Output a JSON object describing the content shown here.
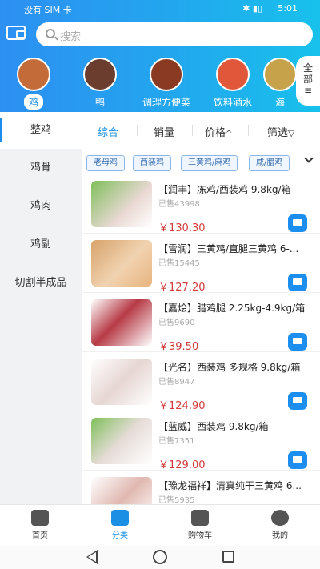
{
  "status": {
    "left": "没有 SIM 卡",
    "time": "5:01",
    "icons": "✱ ▮▯"
  },
  "search": {
    "placeholder": "搜索"
  },
  "categories": [
    {
      "label": "鸡",
      "active": true,
      "color": "#c46b3a"
    },
    {
      "label": "鸭",
      "active": false,
      "color": "#6b3d2e"
    },
    {
      "label": "调理方便菜",
      "active": false,
      "color": "#8a3a22"
    },
    {
      "label": "饮料酒水",
      "active": false,
      "color": "#e0573a"
    },
    {
      "label": "海",
      "active": false,
      "color": "#c6a24a"
    }
  ],
  "all_button": {
    "label_top": "全",
    "label_bottom": "部",
    "icon": "≡"
  },
  "filter": {
    "sort_default": "综合",
    "sort_sales": "销量",
    "sort_price": "价格",
    "filter_label": "筛选"
  },
  "sidebar": {
    "items": [
      {
        "label": "整鸡",
        "active": true
      },
      {
        "label": "鸡骨",
        "active": false
      },
      {
        "label": "鸡肉",
        "active": false
      },
      {
        "label": "鸡副",
        "active": false
      },
      {
        "label": "切割半成品",
        "active": false
      }
    ]
  },
  "tags": [
    "老母鸡",
    "西装鸡",
    "三黄鸡/麻鸡",
    "咸/腊鸡"
  ],
  "products": [
    {
      "name": "【润丰】冻鸡/西装鸡 9.8kg/箱",
      "sold": "已售43998",
      "price": "￥130.30"
    },
    {
      "name": "【雪润】三黄鸡/直腿三黄鸡 6-...",
      "sold": "已售15445",
      "price": "￥127.20"
    },
    {
      "name": "【嘉烩】腊鸡腿 2.25kg-4.9kg/箱",
      "sold": "已售9690",
      "price": "￥39.50"
    },
    {
      "name": "【光名】西装鸡 多规格 9.8kg/箱",
      "sold": "已售8947",
      "price": "￥124.90"
    },
    {
      "name": "【蓝威】西装鸡 9.8kg/箱",
      "sold": "已售7351",
      "price": "￥129.00"
    },
    {
      "name": "【豫龙福祥】清真纯干三黄鸡 6...",
      "sold": "已售5935",
      "price": ""
    }
  ],
  "bottom_nav": [
    {
      "label": "首页",
      "active": false,
      "icon": "home-icon"
    },
    {
      "label": "分类",
      "active": true,
      "icon": "category-icon"
    },
    {
      "label": "购物车",
      "active": false,
      "icon": "cart-icon"
    },
    {
      "label": "我的",
      "active": false,
      "icon": "profile-icon"
    }
  ]
}
